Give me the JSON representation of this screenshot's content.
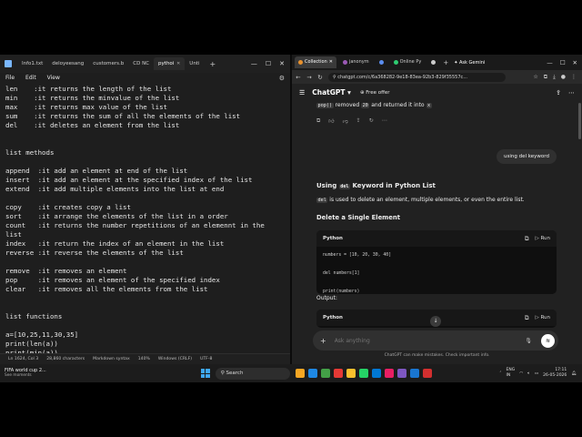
{
  "notepad": {
    "tabs": [
      {
        "label": "Info1.txt",
        "active": false
      },
      {
        "label": "deloyeesang",
        "active": false
      },
      {
        "label": "customers.b",
        "active": false
      },
      {
        "label": "CD NC",
        "active": false
      },
      {
        "label": "pythoi",
        "active": true
      },
      {
        "label": "Unti",
        "active": false
      }
    ],
    "menu": [
      "File",
      "Edit",
      "View"
    ],
    "lines": [
      "len    :it returns the length of the list",
      "min    :it returns the minvalue of the list",
      "max    :it returns max value of the list",
      "sum    :it returns the sum of all the elements of the list",
      "del    :it deletes an element from the list",
      "",
      "",
      "list methods",
      "",
      "append  :it add an element at end of the list",
      "insert  :it add an element at the specified index of the list",
      "extend  :it add multiple elements into the list at end",
      "",
      "copy    :it creates copy a list",
      "sort    :it arrange the elements of the list in a order",
      "count   :it returns the number repetitions of an elemennt in the",
      "list",
      "index   :it return the index of an element in the list",
      "reverse :it reverse the elements of the list",
      "",
      "remove  :it removes an element",
      "pop     :it removes an element of the specified index",
      "clear   :it removes all the elements from the list",
      "",
      "",
      "list functions",
      "",
      "a=[10,25,11,30,35]",
      "print(len(a))",
      "print(min(a))"
    ],
    "status": {
      "position": "Ln 1624, Col 3",
      "characters": "28,860 characters",
      "markdown": "Markdown syntax",
      "zoom": "140%",
      "eol": "Windows (CRLF)",
      "encoding": "UTF-8"
    }
  },
  "browser": {
    "tabs": [
      {
        "label": "Collection",
        "active": true,
        "color": "#e8912d"
      },
      {
        "label": "janonym",
        "active": false,
        "color": "#9b59b6"
      },
      {
        "label": "",
        "active": false,
        "color": "#5b8def"
      },
      {
        "label": "Online Py",
        "active": false,
        "color": "#2ecc71"
      },
      {
        "label": "",
        "active": false,
        "color": "#cccccc"
      }
    ],
    "gemini_label": "Ask Gemini",
    "url": "chatgpt.com/c/6a368282-9e18-83ea-92b3-829f35557c...",
    "chat": {
      "title": "ChatGPT",
      "offer": "Free offer",
      "prev_line_prefix": "removed",
      "prev_code1": "20",
      "prev_mid": "and returned it into",
      "prev_code2": "x",
      "user_message": "using del keyword",
      "heading_pre": "Using",
      "heading_code": "del",
      "heading_post": "Keyword in Python List",
      "intro_code": "del",
      "intro_text": "is used to delete an element, multiple elements, or even the entire list.",
      "subheading": "Delete a Single Element",
      "code_lang": "Python",
      "run_label": "Run",
      "code_lines": [
        "numbers = [10, 20, 30, 40]",
        "",
        "del numbers[1]",
        "",
        "print(numbers)"
      ],
      "output_label": "Output:",
      "output_lang": "Python",
      "input_placeholder": "Ask anything",
      "disclaimer": "ChatGPT can make mistakes. Check important info."
    }
  },
  "taskbar": {
    "weather_title": "FIFA world cup 2...",
    "weather_sub": "See moments",
    "search_label": "Search",
    "lang": "ENG",
    "region": "IN",
    "time": "17:11",
    "date": "26-05-2026",
    "app_colors": [
      "#f5a623",
      "#1e88e5",
      "#43a047",
      "#e53935",
      "#fbc02d",
      "#25d366",
      "#0078d4",
      "#e91e63",
      "#7e57c2",
      "#1976d2",
      "#d32f2f"
    ]
  }
}
